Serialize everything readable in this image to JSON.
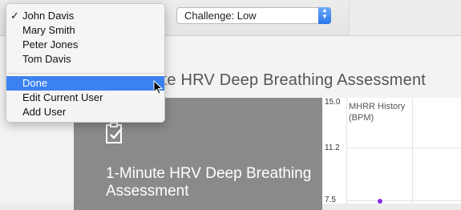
{
  "toolbar": {
    "challenge_select": "Challenge: Low"
  },
  "menu": {
    "users": [
      {
        "label": "John Davis",
        "checked": true
      },
      {
        "label": "Mary Smith",
        "checked": false
      },
      {
        "label": "Peter Jones",
        "checked": false
      },
      {
        "label": "Tom Davis",
        "checked": false
      }
    ],
    "check_glyph": "✓",
    "actions": [
      {
        "label": "Done",
        "highlighted": true
      },
      {
        "label": "Edit Current User",
        "highlighted": false
      },
      {
        "label": "Add User",
        "highlighted": false
      }
    ]
  },
  "main": {
    "page_title_visible": "nute HRV Deep Breathing Assessment",
    "card_title": "1-Minute HRV Deep Breathing Assessment",
    "card_icon": "clipboard-check-icon"
  },
  "chart": {
    "title": "MHRR History (BPM)",
    "ticks": [
      "15.0",
      "11.2",
      "7.5"
    ],
    "series_color": "#8a2be2"
  },
  "colors": {
    "highlight": "#3b82f0",
    "card_bg": "#8a8a8a"
  }
}
